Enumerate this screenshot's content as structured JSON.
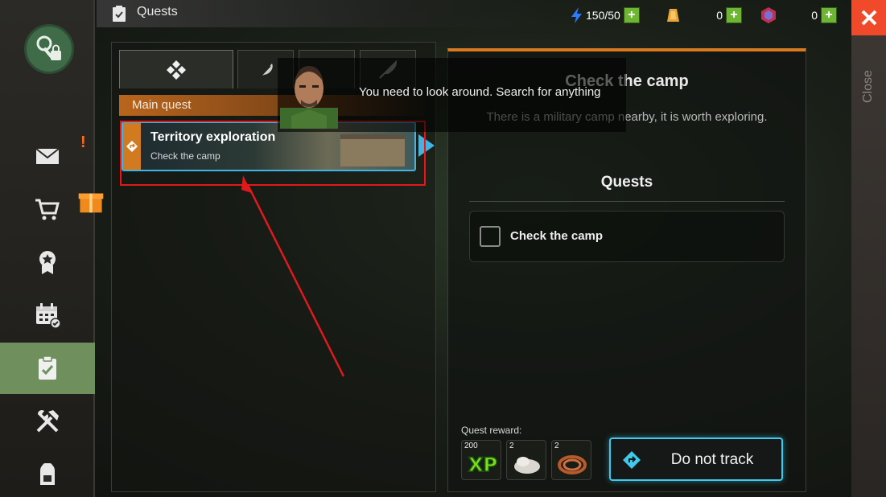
{
  "header": {
    "title": "Quests"
  },
  "resources": {
    "energy": {
      "value": "150/50",
      "icon": "lightning-icon",
      "color": "#2d7bff"
    },
    "gold": {
      "value": "0",
      "icon": "gold-bar-icon",
      "color": "#e8a53a"
    },
    "gems": {
      "value": "0",
      "icon": "crystal-icon",
      "color": "#c2304e"
    }
  },
  "close": {
    "label": "Close"
  },
  "sidebar": {
    "items": [
      {
        "name": "mail"
      },
      {
        "name": "shop"
      },
      {
        "name": "achievements"
      },
      {
        "name": "calendar"
      },
      {
        "name": "quests",
        "active": true
      },
      {
        "name": "crafting"
      },
      {
        "name": "inventory"
      }
    ]
  },
  "tabs": [
    "main",
    "feather",
    "character",
    "knife"
  ],
  "quest_list": {
    "section_label": "Main quest",
    "items": [
      {
        "title": "Territory exploration",
        "subtitle": "Check the camp"
      }
    ]
  },
  "dialogue": {
    "text": "You need to look around. Search for anything"
  },
  "detail": {
    "title": "Check the camp",
    "description": "There is a military camp nearby, it is worth exploring.",
    "quests_heading": "Quests",
    "objectives": [
      {
        "text": "Check the camp",
        "done": false
      }
    ],
    "reward_label": "Quest reward:",
    "rewards": [
      {
        "count": "200",
        "icon": "xp-icon"
      },
      {
        "count": "2",
        "icon": "cloth-icon"
      },
      {
        "count": "2",
        "icon": "rope-icon"
      }
    ],
    "track_button": "Do not track"
  },
  "colors": {
    "accent_orange": "#d87a1f",
    "accent_cyan": "#3fc9ec",
    "highlight_red": "#e01a1a"
  }
}
